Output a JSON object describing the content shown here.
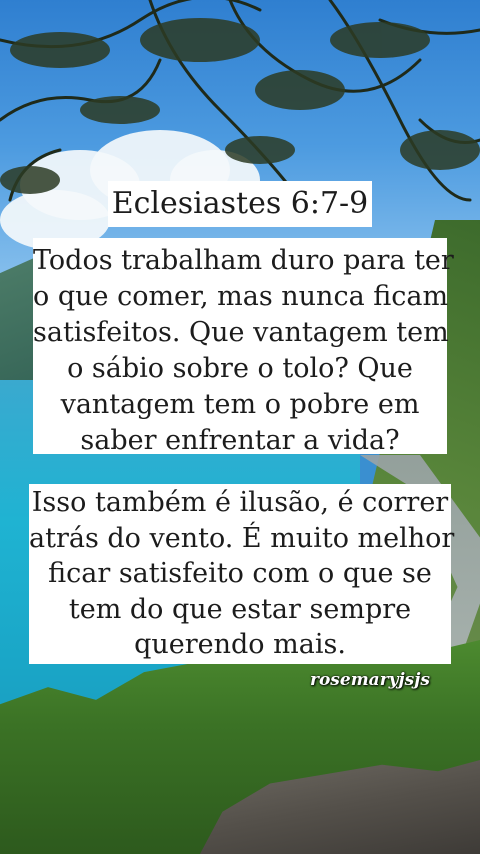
{
  "post": {
    "reference": "Eclesiastes 6:7-9",
    "verse_part1_lines": [
      "Todos trabalham duro para ter",
      "o que comer, mas nunca ficam",
      "satisfeitos. Que vantagem tem",
      "o sábio sobre o tolo? Que",
      "vantagem tem o pobre em",
      "saber enfrentar a vida?"
    ],
    "verse_part2_lines": [
      "Isso também é ilusão, é correr",
      "atrás do vento. É muito melhor",
      "ficar satisfeito com o que se",
      "tem do que estar sempre",
      "querendo mais."
    ],
    "watermark": "rosemaryjsjs"
  },
  "colors": {
    "card_background": "#ffffff",
    "text": "#1c1c1c",
    "sky": "#4d9be0",
    "lake": "#1fb3d2",
    "forest": "#3b7225"
  }
}
